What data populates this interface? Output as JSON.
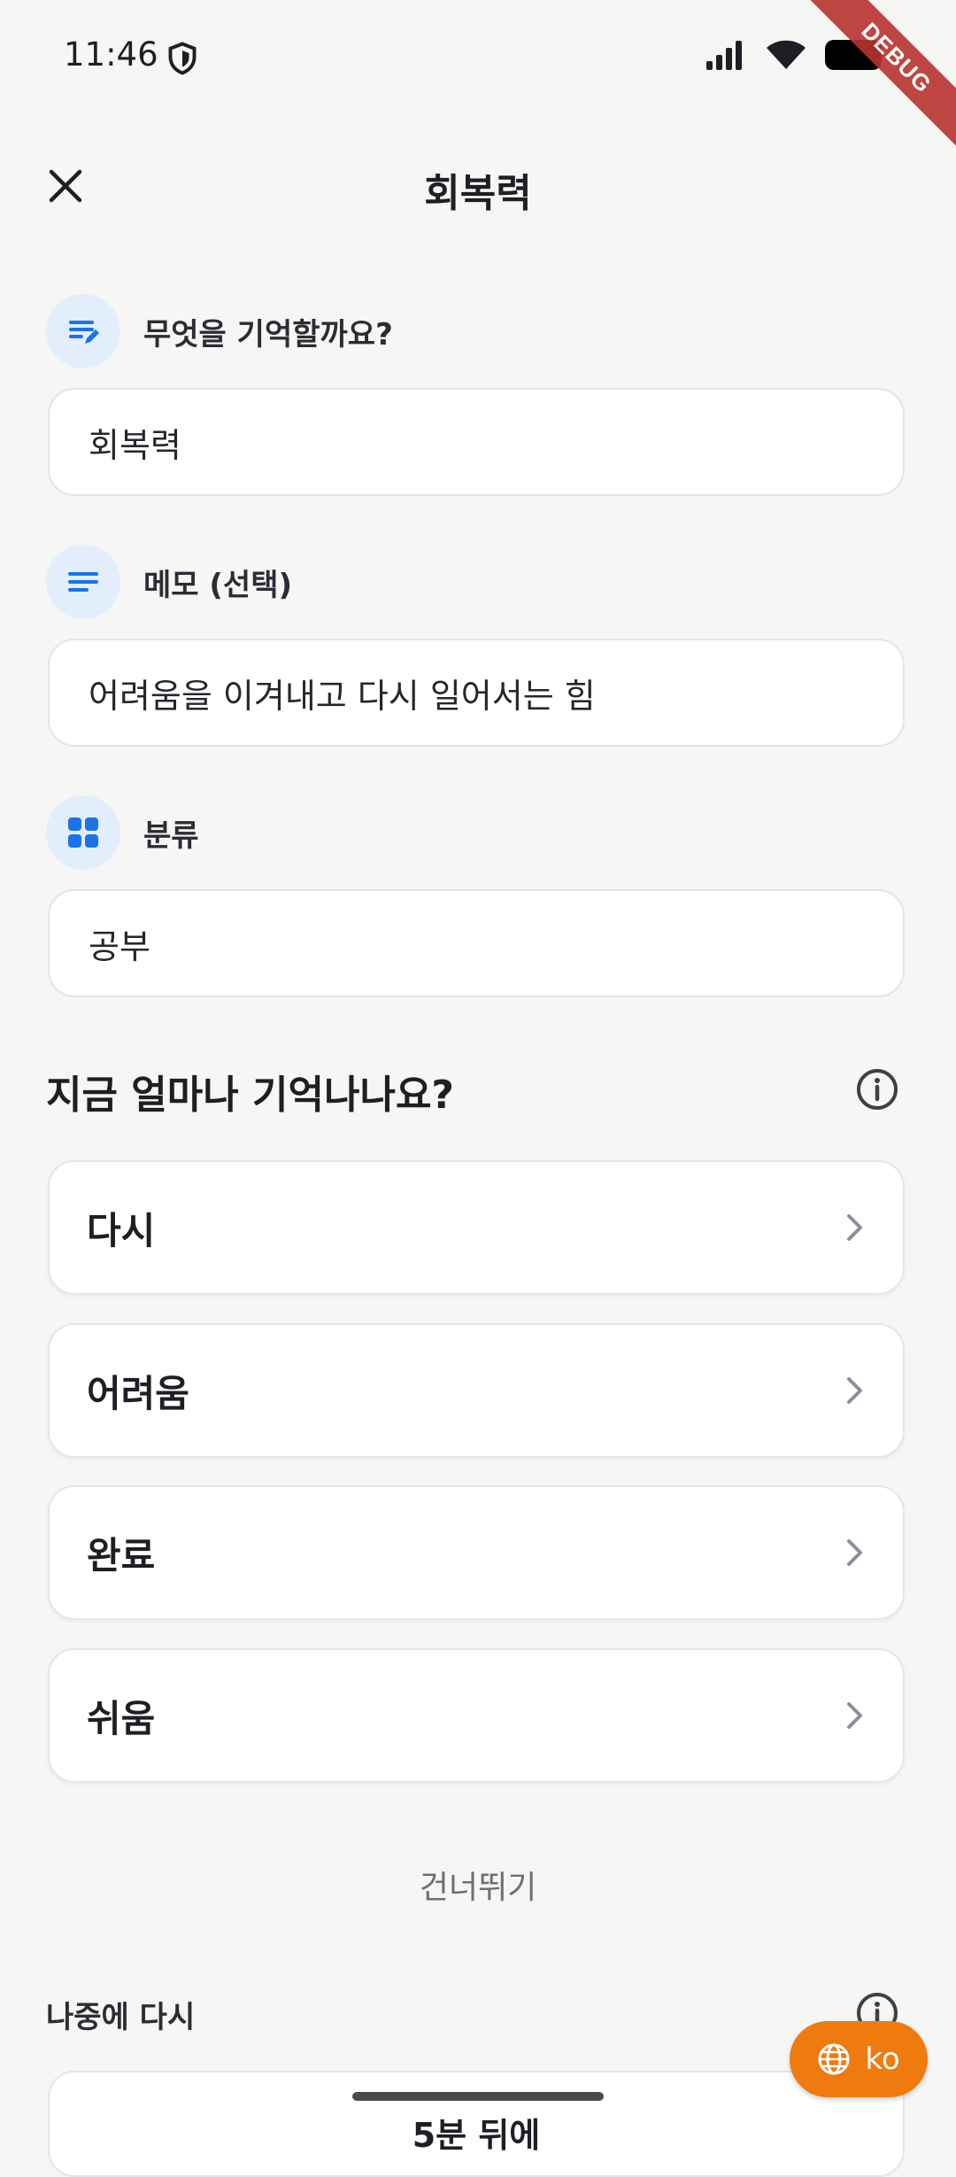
{
  "status_bar": {
    "time": "11:46"
  },
  "debug_banner": "DEBUG",
  "app_bar": {
    "title": "회복력"
  },
  "fields": {
    "question": {
      "label": "무엇을 기억할까요?",
      "value": "회복력"
    },
    "memo": {
      "label": "메모 (선택)",
      "value": "어려움을 이겨내고 다시 일어서는 힘"
    },
    "category": {
      "label": "분류",
      "value": "공부"
    }
  },
  "recall_section": {
    "title": "지금 얼마나 기억나나요?",
    "options": [
      {
        "label": "다시"
      },
      {
        "label": "어려움"
      },
      {
        "label": "완료"
      },
      {
        "label": "쉬움"
      }
    ]
  },
  "skip_label": "건너뛰기",
  "later_section": {
    "title": "나중에 다시",
    "first_option": "5분 뒤에"
  },
  "language_button": {
    "label": "ko"
  },
  "colors": {
    "accent": "#1a73e8",
    "fab": "#ef7a0e",
    "background": "#f6f6f5"
  },
  "icons": {
    "close": "close-icon",
    "question": "edit-note-icon",
    "memo": "notes-icon",
    "category": "grid-icon",
    "info": "info-icon",
    "chevron": "chevron-right-icon",
    "language": "globe-icon"
  }
}
